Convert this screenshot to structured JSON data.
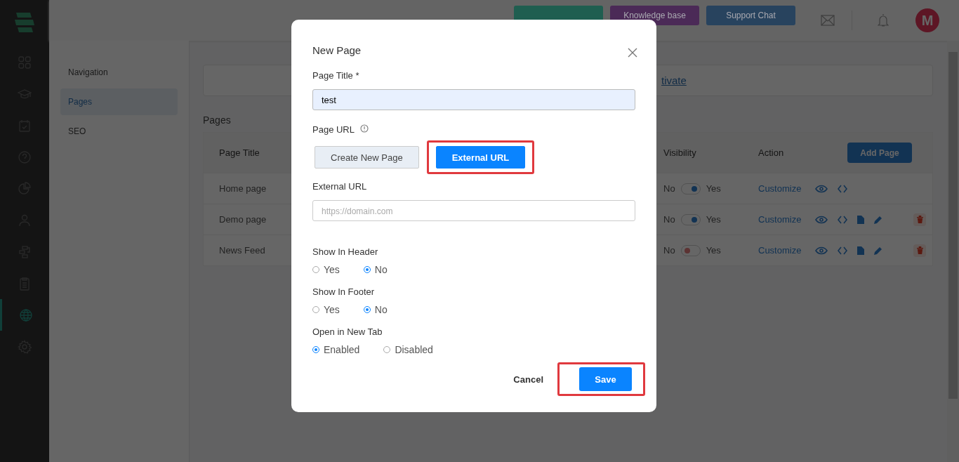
{
  "sidebar": {
    "items": [
      {
        "kind": "grid",
        "selected": false
      },
      {
        "kind": "cap",
        "selected": false
      },
      {
        "kind": "calendar",
        "selected": false
      },
      {
        "kind": "help",
        "selected": false
      },
      {
        "kind": "pie",
        "selected": false
      },
      {
        "kind": "user",
        "selected": false
      },
      {
        "kind": "flow",
        "selected": false
      },
      {
        "kind": "clipboard",
        "selected": false
      },
      {
        "kind": "globe",
        "selected": true
      },
      {
        "kind": "gear",
        "selected": false
      }
    ]
  },
  "header": {
    "buttons": [
      {
        "color": "#1f5e50"
      },
      {
        "label": "Knowledge base",
        "color": "#4b2a57"
      },
      {
        "label": "Support Chat",
        "color": "#28435e"
      }
    ],
    "avatar": "M"
  },
  "subnav": {
    "items": [
      {
        "label": "Navigation",
        "selected": false
      },
      {
        "label": "Pages",
        "selected": true
      },
      {
        "label": "SEO",
        "selected": false
      }
    ]
  },
  "banner": {
    "link": "tivate"
  },
  "pages_heading": "Pages",
  "table": {
    "columns": [
      "Page Title",
      "Visibility",
      "Action"
    ],
    "add_button": "Add Page",
    "rows": [
      {
        "title": "Home page",
        "off_label": "No",
        "on": true,
        "on_label": "Yes",
        "action": "Customize",
        "editable": false
      },
      {
        "title": "Demo page",
        "off_label": "No",
        "on": true,
        "on_label": "Yes",
        "action": "Customize",
        "editable": true
      },
      {
        "title": "News Feed",
        "off_label": "No",
        "on": false,
        "on_label": "Yes",
        "action": "Customize",
        "editable": true
      }
    ]
  },
  "modal": {
    "title": "New Page",
    "page_title": {
      "label": "Page Title *",
      "value": "test"
    },
    "page_url": {
      "label": "Page URL",
      "options": [
        {
          "label": "Create New Page",
          "selected": false
        },
        {
          "label": "External URL",
          "selected": true
        }
      ]
    },
    "external_url": {
      "label": "External URL",
      "placeholder": "https://domain.com"
    },
    "radio_groups": [
      {
        "label": "Show In Header",
        "options": [
          {
            "label": "Yes",
            "selected": false
          },
          {
            "label": "No",
            "selected": true
          }
        ]
      },
      {
        "label": "Show In Footer",
        "options": [
          {
            "label": "Yes",
            "selected": false
          },
          {
            "label": "No",
            "selected": true
          }
        ]
      },
      {
        "label": "Open in New Tab",
        "options": [
          {
            "label": "Enabled",
            "selected": true
          },
          {
            "label": "Disabled",
            "selected": false
          }
        ]
      }
    ],
    "cancel": "Cancel",
    "save": "Save"
  }
}
